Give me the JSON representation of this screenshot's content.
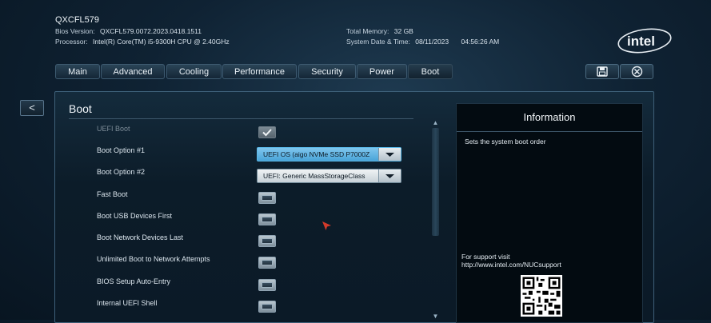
{
  "header": {
    "system_name": "QXCFL579",
    "bios_version_label": "Bios Version:",
    "bios_version": "QXCFL579.0072.2023.0418.1511",
    "processor_label": "Processor:",
    "processor": "Intel(R) Core(TM) i5-9300H CPU @ 2.40GHz",
    "memory_label": "Total Memory:",
    "memory": "32 GB",
    "datetime_label": "System Date & Time:",
    "date": "08/11/2023",
    "time": "04:56:26 AM",
    "logo_text": "intel"
  },
  "tabs": [
    "Main",
    "Advanced",
    "Cooling",
    "Performance",
    "Security",
    "Power",
    "Boot"
  ],
  "active_tab": "Boot",
  "toolbar": {
    "save_icon": "floppy-disk-icon",
    "exit_icon": "close-circle-icon"
  },
  "back_label": "<",
  "panel": {
    "title": "Boot",
    "options": [
      {
        "label": "UEFI Boot",
        "control": "checkbox",
        "checked": true,
        "disabled": true
      },
      {
        "label": "Boot Option #1",
        "control": "select",
        "value": "UEFI OS (aigo NVMe SSD P7000Z"
      },
      {
        "label": "Boot Option #2",
        "control": "select",
        "value": "UEFI: Generic MassStorageClass"
      },
      {
        "label": "Fast Boot",
        "control": "checkbox",
        "checked": false
      },
      {
        "label": "Boot USB Devices First",
        "control": "checkbox",
        "checked": false
      },
      {
        "label": "Boot Network Devices Last",
        "control": "checkbox",
        "checked": false
      },
      {
        "label": "Unlimited Boot to Network Attempts",
        "control": "checkbox",
        "checked": false
      },
      {
        "label": "BIOS Setup Auto-Entry",
        "control": "checkbox",
        "checked": false
      },
      {
        "label": "Internal UEFI Shell",
        "control": "checkbox",
        "checked": false
      }
    ]
  },
  "info": {
    "title": "Information",
    "text": "Sets the system boot order",
    "support_line1": "For support visit",
    "support_line2": "http://www.intel.com/NUCsupport"
  },
  "colors": {
    "accent": "#5ab8e8",
    "background": "#0f2233",
    "panel_border": "#3e6079"
  }
}
